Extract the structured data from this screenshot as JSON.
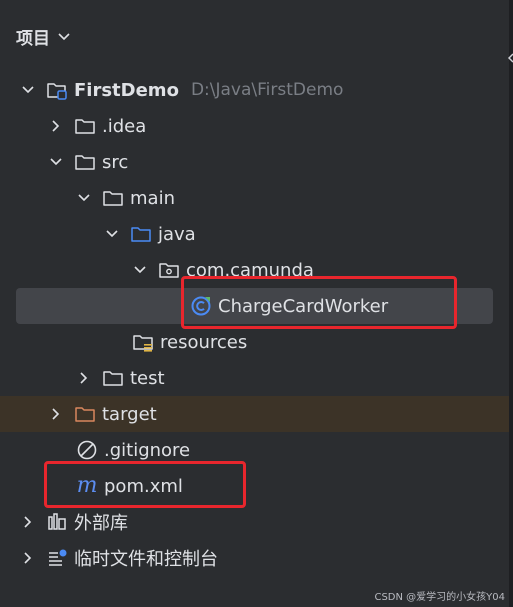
{
  "header": {
    "title": "项目"
  },
  "tree": {
    "project": {
      "name": "FirstDemo",
      "path": "D:\\Java\\FirstDemo"
    },
    "idea": ".idea",
    "src": "src",
    "main": "main",
    "java": "java",
    "package": "com.camunda",
    "worker": "ChargeCardWorker",
    "resources": "resources",
    "test": "test",
    "target": "target",
    "gitignore": ".gitignore",
    "pom": "pom.xml",
    "pom_icon_letter": "m",
    "external_libraries": "外部库",
    "scratches": "临时文件和控制台"
  },
  "watermark": "CSDN @爱学习的小女孩Y04",
  "colors": {
    "background": "#2b2d30",
    "selection": "#43454a",
    "highlight_red": "#e8262d",
    "target_folder": "#d9885e",
    "source_folder": "#4b8bf5",
    "pom_icon": "#5c8df0"
  }
}
